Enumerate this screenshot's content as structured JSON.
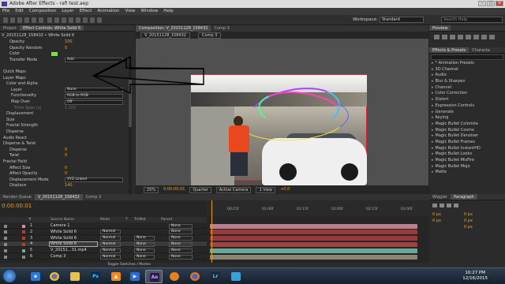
{
  "window": {
    "title": "Adobe After Effects - rafi test.aep"
  },
  "menu": [
    "File",
    "Edit",
    "Composition",
    "Layer",
    "Effect",
    "Animation",
    "View",
    "Window",
    "Help"
  ],
  "toolbar": {
    "workspace_label": "Workspace:",
    "workspace_value": "Standard",
    "search_placeholder": "Search Help"
  },
  "left_panel": {
    "tabs": [
      "Project",
      "Effect Controls: White Solid 6"
    ],
    "subtitle": "V_20151128_158432 • White Solid 6",
    "rows": [
      {
        "label": "Opacity",
        "value": "100",
        "indent": 12
      },
      {
        "label": "Opacity Random",
        "value": "0",
        "indent": 12
      },
      {
        "label": "Color",
        "value": "",
        "indent": 12,
        "swatch": true
      },
      {
        "label": "Transfer Mode",
        "value": "Add",
        "indent": 12,
        "dropdown": true
      },
      {
        "label": "",
        "value": "",
        "indent": 0
      },
      {
        "label": "Quick Maps",
        "value": "",
        "indent": 4
      },
      {
        "label": "Layer Maps",
        "value": "",
        "indent": 4
      },
      {
        "label": "Color and Alpha",
        "value": "",
        "indent": 8
      },
      {
        "label": "Layer",
        "value": "None",
        "indent": 14,
        "dropdown": true
      },
      {
        "label": "Functionality",
        "value": "RGB to RGB",
        "indent": 14,
        "dropdown": true
      },
      {
        "label": "Map Over",
        "value": "Off",
        "indent": 14,
        "dropdown": true
      },
      {
        "label": "Time Span (s)",
        "value": "1.000",
        "indent": 18,
        "dim": true
      },
      {
        "label": "Displacement",
        "value": "",
        "indent": 8
      },
      {
        "label": "Size",
        "value": "",
        "indent": 8
      },
      {
        "label": "Fractal Strength",
        "value": "",
        "indent": 8
      },
      {
        "label": "Disperse",
        "value": "",
        "indent": 8
      },
      {
        "label": "Audio React",
        "value": "",
        "indent": 4
      },
      {
        "label": "Disperse & Twist",
        "value": "",
        "indent": 4
      },
      {
        "label": "Disperse",
        "value": "0",
        "indent": 12
      },
      {
        "label": "Twist",
        "value": "0",
        "indent": 12
      },
      {
        "label": "Fractal Field",
        "value": "",
        "indent": 4
      },
      {
        "label": "Affect Size",
        "value": "0",
        "indent": 12
      },
      {
        "label": "Affect Opacity",
        "value": "0",
        "indent": 12
      },
      {
        "label": "Displacement Mode",
        "value": "XYZ Linked",
        "indent": 12,
        "dropdown": true
      },
      {
        "label": "Displace",
        "value": "140",
        "indent": 12
      }
    ]
  },
  "viewer": {
    "tabs": [
      "Composition: V_20151128_158432",
      "Comp 3"
    ],
    "breadcrumbs": [
      "V_20151128_158432",
      "Comp 3"
    ],
    "footer": {
      "zoom": "25%",
      "timecode": "0:00:00:01",
      "quality": "Quarter",
      "camera": "Active Camera",
      "views": "1 View",
      "exposure": "+0.0"
    }
  },
  "right_panel": {
    "preview_tabs": [
      "Preview"
    ],
    "effects_tabs": [
      "Effects & Presets",
      "Characte"
    ],
    "effects": [
      "* Animation Presets",
      "3D Channel",
      "Audio",
      "Blur & Sharpen",
      "Channel",
      "Color Correction",
      "Distort",
      "Expression Controls",
      "Generate",
      "Keying",
      "Magic Bullet Colorista",
      "Magic Bullet Cosmo",
      "Magic Bullet Denoiser",
      "Magic Bullet Frames",
      "Magic Bullet InstantHD",
      "Magic Bullet Looks",
      "Magic Bullet MisFire",
      "Magic Bullet Mojo",
      "Matte"
    ],
    "bottom_tabs": [
      "Wiggler",
      "Paragraph"
    ],
    "para_values": [
      "0 px",
      "0 px",
      "0 px",
      "0 px",
      "0 px"
    ]
  },
  "timeline": {
    "tabs": [
      "Render Queue",
      "V_20151128_158432",
      "Comp 3"
    ],
    "timecode": "0:00:00:01",
    "columns": [
      "#",
      "Source Name",
      "Mode",
      "T",
      "TrkMat",
      "Parent"
    ],
    "ruler": [
      "00:15f",
      "01:00f",
      "01:15f",
      "02:00f",
      "02:15f",
      "03:00f",
      "03:15f",
      "04:00f"
    ],
    "layers": [
      {
        "num": "1",
        "name": "Camera 1",
        "mode": "",
        "trk": "",
        "parent": "None",
        "color": "#d18ca8",
        "bar": "#b98090"
      },
      {
        "num": "2",
        "name": "White Solid 6",
        "mode": "Normal",
        "trk": "",
        "parent": "None",
        "color": "#c0392b",
        "bar": "#9a3a3a"
      },
      {
        "num": "3",
        "name": "White Solid 6",
        "mode": "Normal",
        "trk": "None",
        "parent": "None",
        "color": "#c0392b",
        "bar": "#9a3a3a"
      },
      {
        "num": "4",
        "name": "White Solid 6",
        "mode": "Normal",
        "trk": "None",
        "parent": "None",
        "color": "#c0392b",
        "bar": "#a34040",
        "selected": true
      },
      {
        "num": "5",
        "name": "V_20151...31.mp4",
        "mode": "Normal",
        "trk": "None",
        "parent": "None",
        "color": "#5fb0a0",
        "bar": "#6aa89a"
      },
      {
        "num": "6",
        "name": "Comp 3",
        "mode": "Normal",
        "trk": "None",
        "parent": "None",
        "color": "#8a8a6a",
        "bar": "#8a8470"
      }
    ],
    "footer": "Toggle Switches / Modes"
  },
  "taskbar": {
    "time": "10:27 PM",
    "date": "12/16/2015",
    "apps": [
      "start",
      "ie",
      "chrome",
      "folder",
      "photoshop",
      "vlc",
      "mediaplayer",
      "aftereffects",
      "blender",
      "firefox",
      "lightroom",
      "wifi"
    ]
  }
}
